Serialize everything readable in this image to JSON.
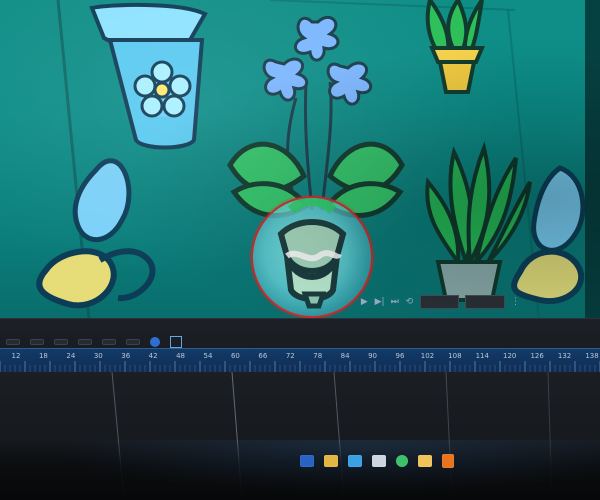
{
  "app": {
    "accent": "#d12a2a",
    "stage_color": "#0f8e86",
    "timeline_blue": "#123a67"
  },
  "transport": {
    "icons": [
      "play-icon",
      "next-frame-icon",
      "end-icon",
      "loop-icon"
    ]
  },
  "timeline": {
    "ruler_numbers": [
      "12",
      "18",
      "24",
      "30",
      "36",
      "42",
      "48",
      "54",
      "60",
      "66",
      "72",
      "78",
      "84",
      "90",
      "96",
      "102",
      "108",
      "114",
      "120",
      "126",
      "132",
      "138"
    ],
    "toolbar_items": [
      "",
      "",
      "",
      "",
      "",
      ""
    ]
  },
  "taskbar": {
    "icons": [
      {
        "name": "windows-icon",
        "color": "#2b6bd6"
      },
      {
        "name": "explorer-icon",
        "color": "#e2b640"
      },
      {
        "name": "edge-icon",
        "color": "#3aa0e6"
      },
      {
        "name": "mail-icon",
        "color": "#cdd5df"
      },
      {
        "name": "chat-icon",
        "color": "#3cc26a"
      },
      {
        "name": "app-icon",
        "color": "#f0c25a"
      },
      {
        "name": "orange-app-icon",
        "color": "#e8741f"
      }
    ]
  }
}
